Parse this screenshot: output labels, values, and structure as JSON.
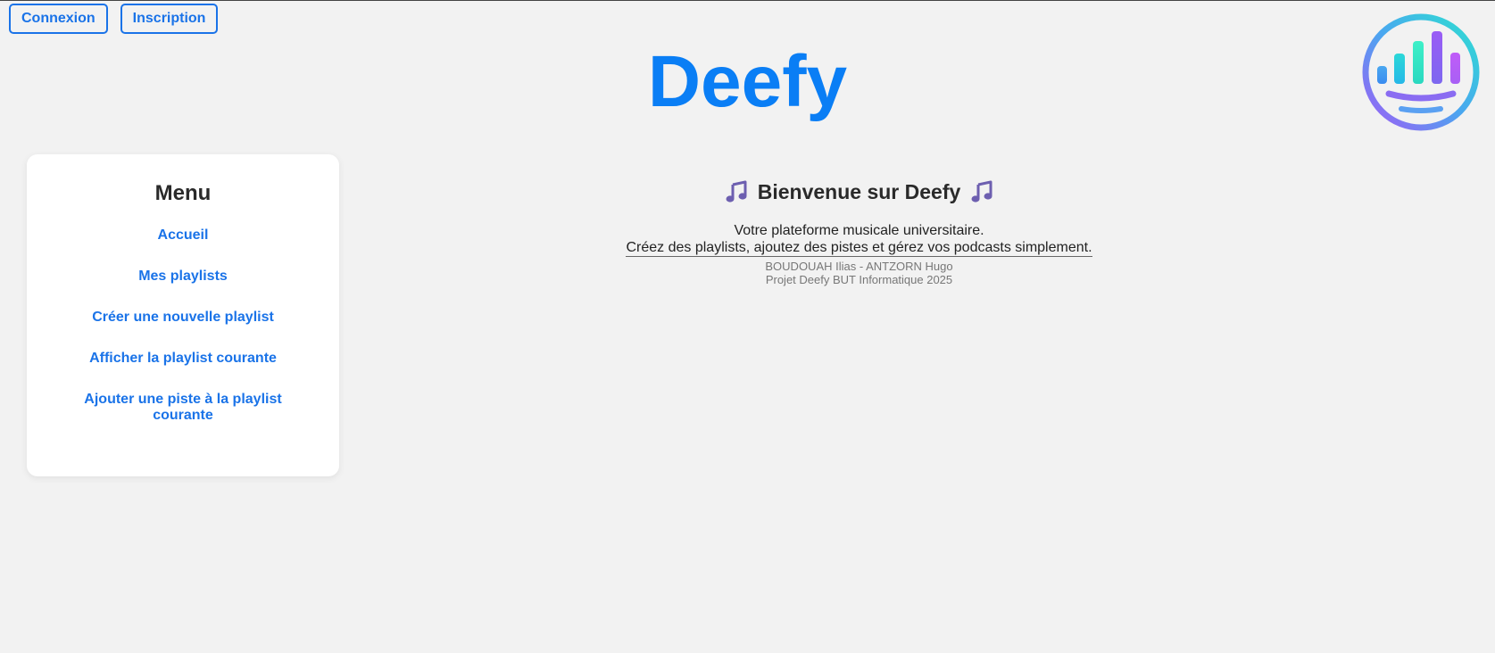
{
  "auth": {
    "login_label": "Connexion",
    "signup_label": "Inscription"
  },
  "header": {
    "title": "Deefy",
    "logo_icon": "equalizer-logo-icon"
  },
  "menu": {
    "title": "Menu",
    "items": [
      {
        "label": "Accueil"
      },
      {
        "label": "Mes playlists"
      },
      {
        "label": "Créer une nouvelle playlist"
      },
      {
        "label": "Afficher la playlist courante"
      },
      {
        "label": "Ajouter une piste à la playlist courante"
      }
    ]
  },
  "main": {
    "heading": "Bienvenue sur Deefy",
    "heading_icon": "music-note-icon",
    "tagline_line1": "Votre plateforme musicale universitaire.",
    "tagline_line2": "Créez des playlists, ajoutez des pistes et gérez vos podcasts simplement.",
    "credits_line1": "BOUDOUAH Ilias - ANTZORN Hugo",
    "credits_line2": "Projet Deefy BUT Informatique 2025"
  },
  "colors": {
    "accent": "#1a73e8",
    "title": "#0a7ef5",
    "background": "#f2f2f2",
    "card": "#ffffff"
  }
}
